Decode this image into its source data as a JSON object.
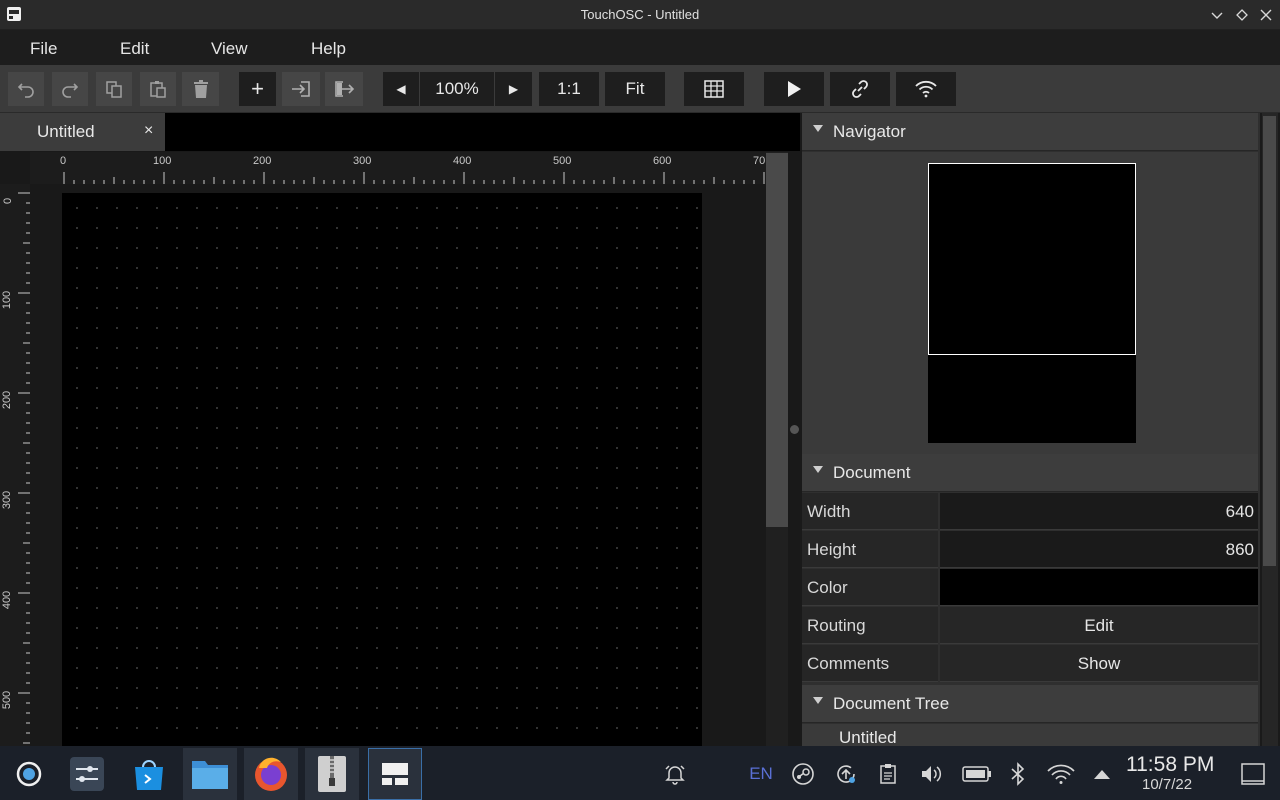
{
  "window": {
    "title": "TouchOSC - Untitled"
  },
  "menu": [
    "File",
    "Edit",
    "View",
    "Help"
  ],
  "toolbar": {
    "zoom": "100%",
    "one_to_one": "1:1",
    "fit": "Fit",
    "add": "+"
  },
  "tabs": [
    {
      "label": "Untitled",
      "close": "×"
    }
  ],
  "ruler": {
    "top": [
      "0",
      "100",
      "200",
      "300",
      "400",
      "500",
      "600",
      "70"
    ],
    "left": [
      "0",
      "100",
      "200",
      "300",
      "400",
      "500"
    ]
  },
  "panel": {
    "navigator": {
      "title": "Navigator"
    },
    "document": {
      "title": "Document",
      "width_label": "Width",
      "width_value": "640",
      "height_label": "Height",
      "height_value": "860",
      "color_label": "Color",
      "routing_label": "Routing",
      "routing_value": "Edit",
      "comments_label": "Comments",
      "comments_value": "Show"
    },
    "tree": {
      "title": "Document Tree",
      "item": "Untitled"
    }
  },
  "taskbar": {
    "lang": "EN",
    "time": "11:58 PM",
    "date": "10/7/22"
  },
  "colors": {
    "accent": "#4fa3e3",
    "doc_bg": "#000000",
    "panel": "#2f2f2f"
  }
}
